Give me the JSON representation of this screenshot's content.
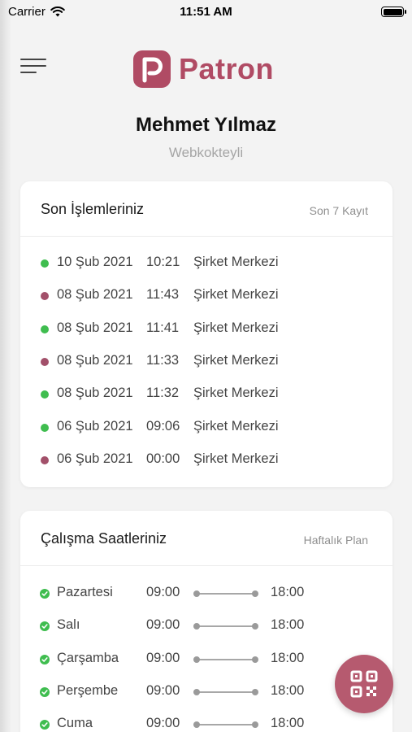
{
  "status_bar": {
    "carrier": "Carrier",
    "time": "11:51 AM"
  },
  "header": {
    "logo_text": "Patron",
    "user_name": "Mehmet Yılmaz",
    "company": "Webkokteyli"
  },
  "colors": {
    "brand": "#b04b64",
    "in_dot": "#3fbd4f",
    "out_dot": "#a2506a"
  },
  "transactions_card": {
    "title": "Son İşlemleriniz",
    "subtitle": "Son 7 Kayıt",
    "items": [
      {
        "date": "10 Şub 2021",
        "time": "10:21",
        "place": "Şirket Merkezi",
        "status": "in"
      },
      {
        "date": "08 Şub 2021",
        "time": "11:43",
        "place": "Şirket Merkezi",
        "status": "out"
      },
      {
        "date": "08 Şub 2021",
        "time": "11:41",
        "place": "Şirket Merkezi",
        "status": "in"
      },
      {
        "date": "08 Şub 2021",
        "time": "11:33",
        "place": "Şirket Merkezi",
        "status": "out"
      },
      {
        "date": "08 Şub 2021",
        "time": "11:32",
        "place": "Şirket Merkezi",
        "status": "in"
      },
      {
        "date": "06 Şub 2021",
        "time": "09:06",
        "place": "Şirket Merkezi",
        "status": "in"
      },
      {
        "date": "06 Şub 2021",
        "time": "00:00",
        "place": "Şirket Merkezi",
        "status": "out"
      }
    ]
  },
  "working_hours_card": {
    "title": "Çalışma Saatleriniz",
    "subtitle": "Haftalık Plan",
    "items": [
      {
        "day": "Pazartesi",
        "start": "09:00",
        "end": "18:00"
      },
      {
        "day": "Salı",
        "start": "09:00",
        "end": "18:00"
      },
      {
        "day": "Çarşamba",
        "start": "09:00",
        "end": "18:00"
      },
      {
        "day": "Perşembe",
        "start": "09:00",
        "end": "18:00"
      },
      {
        "day": "Cuma",
        "start": "09:00",
        "end": "18:00"
      }
    ]
  },
  "fab": {
    "icon": "qr-code-icon"
  }
}
